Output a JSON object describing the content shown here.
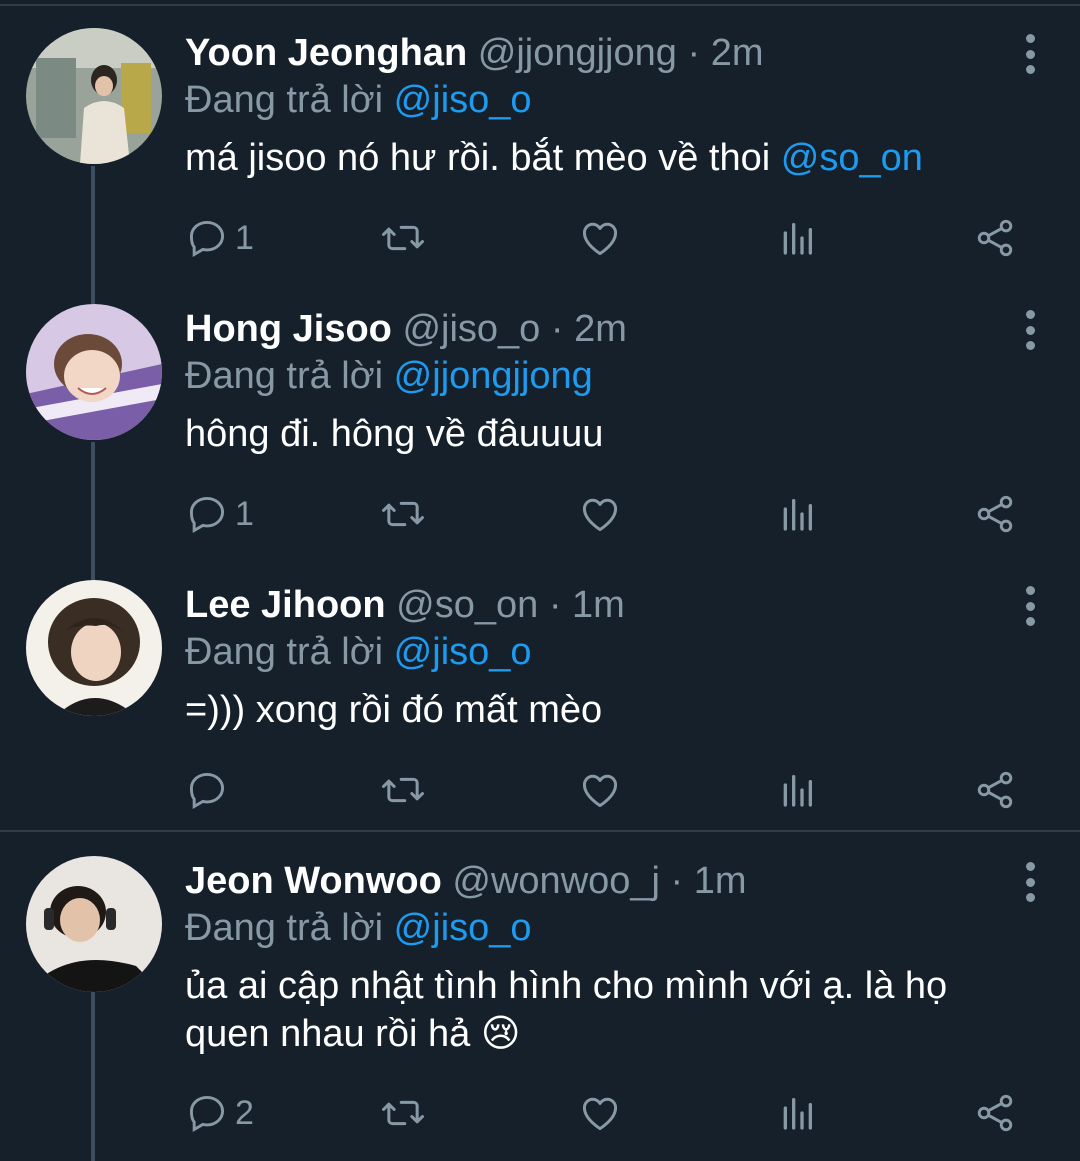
{
  "colors": {
    "background": "#15202b",
    "muted": "#8899a6",
    "mention": "#1d9bf0",
    "divider": "#2f3b47"
  },
  "reply_prefix": "Đang trả lời",
  "tweets": [
    {
      "name": "Yoon Jeonghan",
      "handle": "@jjongjjong",
      "time": "2m",
      "reply_to": "@jiso_o",
      "text": "má jisoo nó hư rồi. bắt mèo về thoi ",
      "text_mention": "@so_on",
      "text_line2": "",
      "emoji": "",
      "reply_count": "1"
    },
    {
      "name": "Hong Jisoo",
      "handle": "@jiso_o",
      "time": "2m",
      "reply_to": "@jjongjjong",
      "text": "hông đi. hông về đâuuuu",
      "text_mention": "",
      "text_line2": "",
      "emoji": "",
      "reply_count": "1"
    },
    {
      "name": "Lee Jihoon",
      "handle": "@so_on",
      "time": "1m",
      "reply_to": "@jiso_o",
      "text": "=))) xong rồi đó mất mèo",
      "text_mention": "",
      "text_line2": "",
      "emoji": "",
      "reply_count": ""
    },
    {
      "name": "Jeon Wonwoo",
      "handle": "@wonwoo_j",
      "time": "1m",
      "reply_to": "@jiso_o",
      "text": "ủa ai cập nhật tình hình cho mình với ạ. là họ",
      "text_mention": "",
      "text_line2": "quen nhau rồi hả ",
      "emoji": "😢",
      "reply_count": "2"
    }
  ],
  "icons": [
    "reply-icon",
    "retweet-icon",
    "like-icon",
    "analytics-icon",
    "share-icon",
    "more-icon"
  ]
}
